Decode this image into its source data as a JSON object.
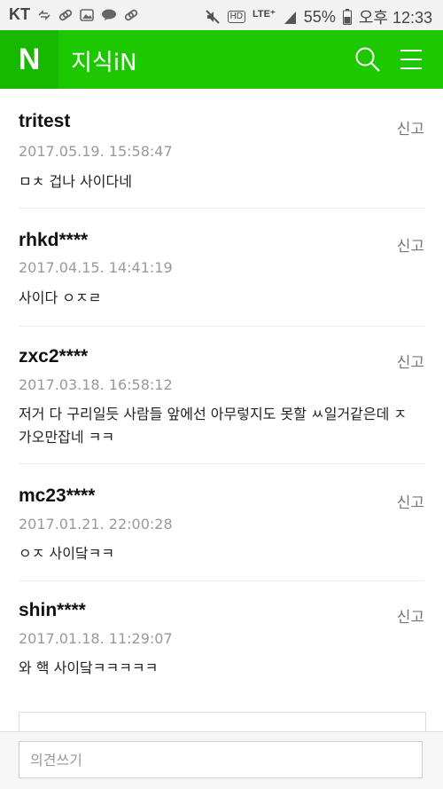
{
  "status_bar": {
    "carrier": "KT",
    "hd": "HD",
    "network": "LTE⁺",
    "battery": "55%",
    "time": "오후 12:33"
  },
  "app_bar": {
    "logo": "N",
    "title": "지식iN"
  },
  "comments": [
    {
      "user": "tritest",
      "date": "2017.05.19. 15:58:47",
      "text": "ㅁㅊ 겁나 사이다네",
      "report": "신고"
    },
    {
      "user": "rhkd****",
      "date": "2017.04.15. 14:41:19",
      "text": "사이다 ㅇㅈㄹ",
      "report": "신고"
    },
    {
      "user": "zxc2****",
      "date": "2017.03.18. 16:58:12",
      "text": "저거 다 구리일듯 사람들 앞에선 아무렇지도 못할 ㅆ일거같은데 ㅈ 가오만잡네 ㅋㅋ",
      "report": "신고"
    },
    {
      "user": "mc23****",
      "date": "2017.01.21. 22:00:28",
      "text": "ㅇㅈ 사이닼ㅋㅋ",
      "report": "신고"
    },
    {
      "user": "shin****",
      "date": "2017.01.18. 11:29:07",
      "text": "와 핵 사이닼ㅋㅋㅋㅋㅋ",
      "report": "신고"
    }
  ],
  "compose": {
    "placeholder": "의견쓰기"
  }
}
